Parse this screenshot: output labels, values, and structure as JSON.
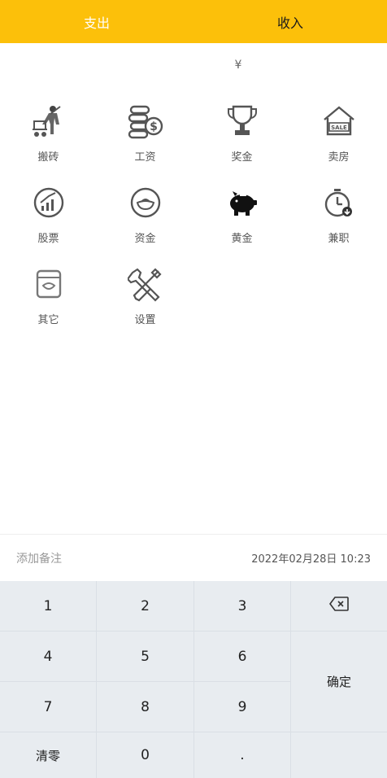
{
  "header": {
    "tab_expense": "支出",
    "tab_income": "收入"
  },
  "amount": {
    "currency": "¥"
  },
  "categories": [
    {
      "label": "搬砖",
      "icon": "worker-cart-icon"
    },
    {
      "label": "工资",
      "icon": "coins-dollar-icon"
    },
    {
      "label": "奖金",
      "icon": "trophy-icon"
    },
    {
      "label": "卖房",
      "icon": "house-sale-icon"
    },
    {
      "label": "股票",
      "icon": "stock-chart-icon"
    },
    {
      "label": "资金",
      "icon": "gold-ingot-icon"
    },
    {
      "label": "黄金",
      "icon": "piggy-bank-icon"
    },
    {
      "label": "兼职",
      "icon": "clock-icon"
    },
    {
      "label": "其它",
      "icon": "box-icon"
    },
    {
      "label": "设置",
      "icon": "tools-icon"
    }
  ],
  "note": {
    "placeholder": "添加备注",
    "datetime": "2022年02月28日 10:23"
  },
  "keypad": {
    "k1": "1",
    "k2": "2",
    "k3": "3",
    "k4": "4",
    "k5": "5",
    "k6": "6",
    "k7": "7",
    "k8": "8",
    "k9": "9",
    "clear": "清零",
    "k0": "0",
    "dot": ".",
    "confirm": "确定",
    "backspace_icon": "backspace-icon"
  },
  "colors": {
    "accent": "#FCC00A",
    "keypad_bg": "#E8ECF0"
  }
}
